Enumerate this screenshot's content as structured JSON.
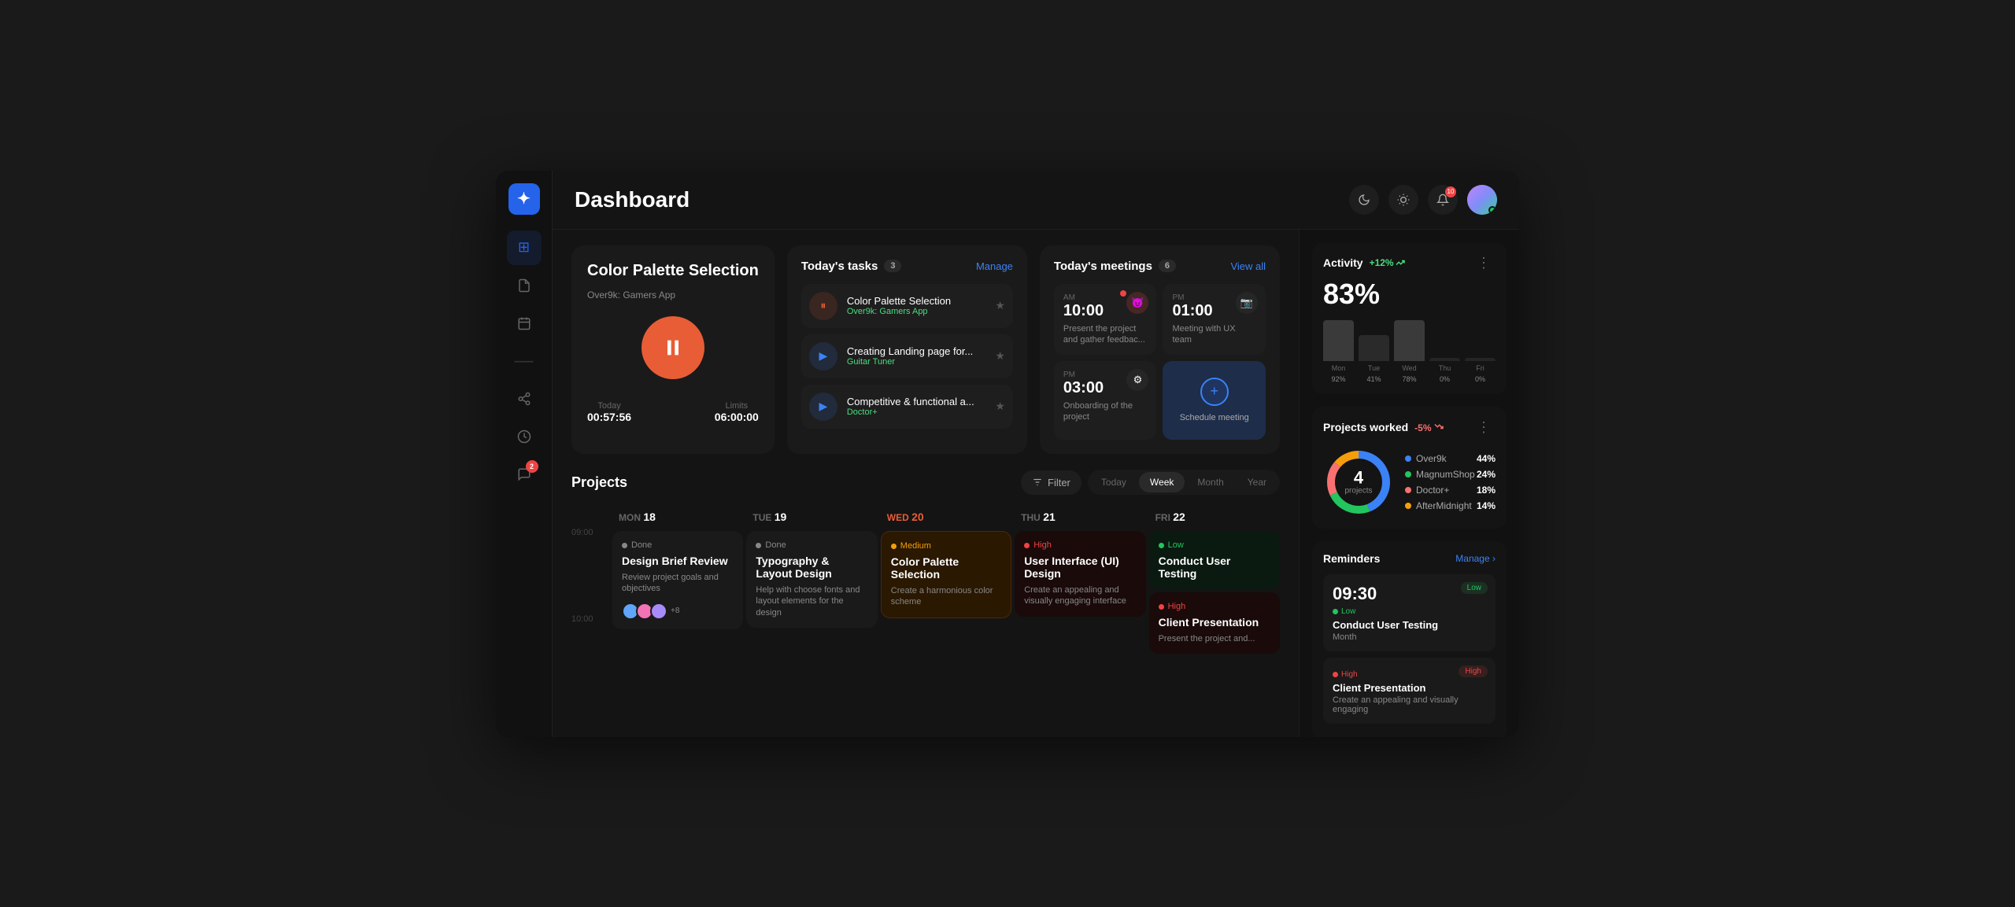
{
  "header": {
    "title": "Dashboard",
    "notification_count": "10"
  },
  "sidebar": {
    "logo": "✦",
    "items": [
      {
        "id": "dashboard",
        "icon": "⊞",
        "active": true
      },
      {
        "id": "document",
        "icon": "⊟"
      },
      {
        "id": "calendar",
        "icon": "⊡"
      },
      {
        "id": "divider",
        "icon": "—"
      },
      {
        "id": "share",
        "icon": "⎇"
      },
      {
        "id": "history",
        "icon": "◷"
      },
      {
        "id": "messages",
        "icon": "💬",
        "badge": "2"
      }
    ]
  },
  "active_task": {
    "title": "Color Palette Selection",
    "subtitle": "Over9k: Gamers App",
    "today_label": "Today",
    "today_value": "00:57:56",
    "limits_label": "Limits",
    "limits_value": "06:00:00"
  },
  "todays_tasks": {
    "title": "Today's tasks",
    "count": "3",
    "action": "Manage",
    "items": [
      {
        "name": "Color Palette Selection",
        "project": "Over9k: Gamers App",
        "icon": "⏸",
        "icon_type": "orange",
        "starred": true
      },
      {
        "name": "Creating Landing page for...",
        "project": "Guitar Tuner",
        "icon": "▶",
        "icon_type": "blue",
        "starred": true
      },
      {
        "name": "Competitive & functional a...",
        "project": "Doctor+",
        "icon": "▶",
        "icon_type": "blue",
        "starred": true
      }
    ]
  },
  "todays_meetings": {
    "title": "Today's meetings",
    "count": "6",
    "action": "View all",
    "meetings": [
      {
        "period": "AM",
        "time": "10:00",
        "desc": "Present the project and gather feedbac...",
        "icon": "😈",
        "icon_bg": "#ef444433",
        "has_dot": true
      },
      {
        "period": "PM",
        "time": "01:00",
        "desc": "Meeting with UX team",
        "icon": "📷",
        "icon_bg": "#33333333",
        "has_dot": false
      },
      {
        "period": "PM",
        "time": "03:00",
        "desc": "Onboarding of the project",
        "icon": "⚙",
        "icon_bg": "#33333333",
        "has_dot": false
      },
      {
        "type": "schedule",
        "label": "Schedule meeting"
      }
    ]
  },
  "projects": {
    "title": "Projects",
    "filter_label": "Filter",
    "tabs": [
      "Today",
      "Week",
      "Month",
      "Year"
    ],
    "active_tab": "Week",
    "days": [
      {
        "label": "MON",
        "day": "18",
        "today": false,
        "cards": [
          {
            "status": "Done",
            "status_color": "#888",
            "title": "Design Brief Review",
            "desc": "Review project goals and objectives",
            "type": "done",
            "avatars": [
              "#60a5fa",
              "#f472b6",
              "#a78bfa"
            ],
            "extra_count": "+8"
          }
        ]
      },
      {
        "label": "TUE",
        "day": "19",
        "today": false,
        "cards": [
          {
            "status": "Done",
            "status_color": "#888",
            "title": "Typography & Layout Design",
            "desc": "Help with choose fonts and layout elements for the design",
            "type": "done"
          }
        ]
      },
      {
        "label": "WED",
        "day": "20",
        "today": true,
        "cards": [
          {
            "status": "Medium",
            "status_color": "#f59e0b",
            "title": "Color Palette Selection",
            "desc": "Create a harmonious color scheme",
            "type": "medium"
          }
        ]
      },
      {
        "label": "THU",
        "day": "21",
        "today": false,
        "cards": [
          {
            "status": "High",
            "status_color": "#ef4444",
            "title": "User Interface (UI) Design",
            "desc": "Create an appealing and visually engaging interface",
            "type": "high-red"
          }
        ]
      },
      {
        "label": "FRI",
        "day": "22",
        "today": false,
        "cards": [
          {
            "status": "Low",
            "status_color": "#22c55e",
            "title": "Conduct User Testing",
            "desc": "",
            "type": "low-green"
          },
          {
            "status": "High",
            "status_color": "#ef4444",
            "title": "Client Presentation",
            "desc": "Present the project and...",
            "type": "high-red"
          }
        ]
      }
    ],
    "time_labels": [
      "09:00",
      "10:00"
    ]
  },
  "activity": {
    "title": "Activity",
    "badge": "+12%",
    "percent": "83%",
    "bars": [
      {
        "label": "Mon",
        "pct": 92,
        "height_pct": 92
      },
      {
        "label": "Tue",
        "pct": 41,
        "height_pct": 41
      },
      {
        "label": "Wed",
        "pct": 78,
        "height_pct": 78
      },
      {
        "label": "Thu",
        "pct": 0,
        "height_pct": 5
      },
      {
        "label": "Fri",
        "pct": 0,
        "height_pct": 5
      }
    ]
  },
  "projects_worked": {
    "title": "Projects worked",
    "badge": "-5%",
    "center_count": "4",
    "center_label": "projects",
    "legend": [
      {
        "name": "Over9k",
        "pct": "44%",
        "color": "#3b82f6"
      },
      {
        "name": "MagnumShop",
        "pct": "24%",
        "color": "#22c55e"
      },
      {
        "name": "Doctor+",
        "pct": "18%",
        "color": "#f87171"
      },
      {
        "name": "AfterMidnight",
        "pct": "14%",
        "color": "#f59e0b"
      }
    ],
    "donut_segments": [
      {
        "color": "#3b82f6",
        "pct": 44
      },
      {
        "color": "#22c55e",
        "pct": 24
      },
      {
        "color": "#f87171",
        "pct": 18
      },
      {
        "color": "#f59e0b",
        "pct": 14
      }
    ]
  },
  "reminders": {
    "title": "Reminders",
    "action": "Manage",
    "items": [
      {
        "time": "09:30",
        "priority": "Low",
        "priority_color": "#22c55e",
        "name": "Conduct User Testing",
        "desc": "Month",
        "badge": "Low",
        "badge_type": "low"
      },
      {
        "time": "",
        "priority": "High",
        "priority_color": "#ef4444",
        "name": "Client Presentation",
        "desc": "Create an appealing and visually engaging",
        "badge": "High",
        "badge_type": "high"
      }
    ]
  }
}
